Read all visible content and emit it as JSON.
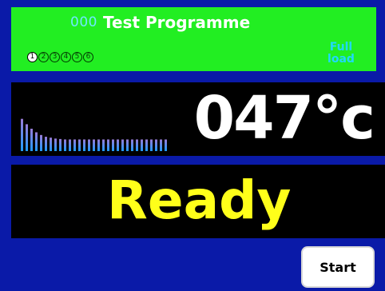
{
  "header": {
    "programme_number": "000",
    "programme_name": "Test Programme",
    "stages": [
      "1",
      "2",
      "3",
      "4",
      "5",
      "6"
    ],
    "active_stage": 1,
    "load": "Full load"
  },
  "temperature": {
    "value": "047°c",
    "bar_levels": [
      0.72,
      0.6,
      0.5,
      0.42,
      0.36,
      0.32,
      0.3,
      0.28,
      0.27,
      0.26,
      0.26,
      0.26,
      0.26,
      0.26,
      0.26,
      0.26,
      0.26,
      0.26,
      0.26,
      0.26,
      0.26,
      0.26,
      0.26,
      0.26,
      0.26,
      0.26,
      0.26,
      0.26,
      0.26,
      0.26,
      0.26
    ]
  },
  "status": {
    "text": "Ready"
  },
  "controls": {
    "start_label": "Start"
  },
  "colors": {
    "background": "#0a1aa8",
    "header": "#22ee22",
    "temperature_text": "#ffffff",
    "status_text": "#ffff1a",
    "bar_top": "#9a7bd6",
    "bar_bottom": "#1e9bff"
  }
}
